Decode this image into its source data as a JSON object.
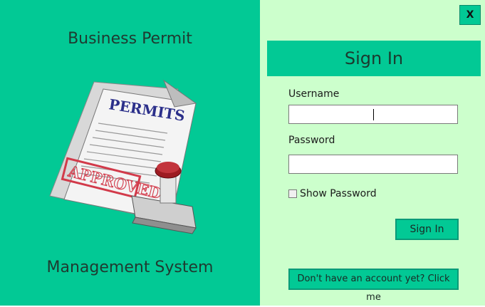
{
  "brand": {
    "title_line1": "Business Permit",
    "title_line2": "Management System",
    "logo_stamp_text": "APPROVED",
    "logo_header_text": "PERMITS"
  },
  "window": {
    "close_label": "X"
  },
  "form": {
    "heading": "Sign In",
    "username_label": "Username",
    "username_value": "",
    "password_label": "Password",
    "password_value": "",
    "show_password_label": "Show Password",
    "show_password_checked": false,
    "signin_label": "Sign In",
    "create_account_label": "Don't have an account yet? Click me"
  },
  "colors": {
    "panel_green": "#02c995",
    "form_background": "#ccffcc",
    "brand_text": "#1f3a30"
  }
}
